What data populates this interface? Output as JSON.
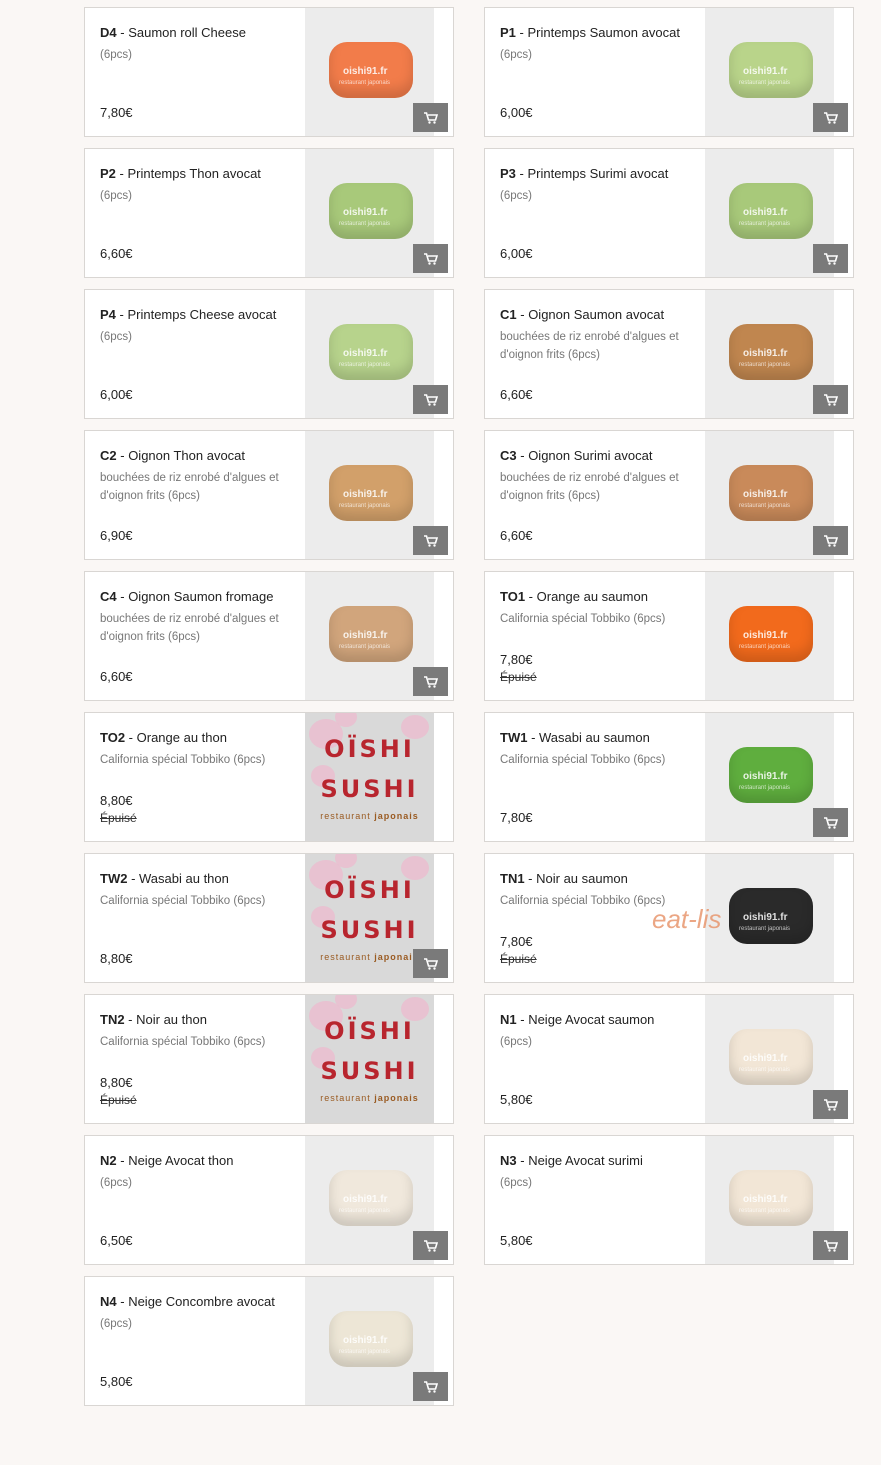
{
  "products": [
    {
      "code": "D4",
      "name": "Saumon roll Cheese",
      "desc": "(6pcs)",
      "price": "7,80€",
      "status": "",
      "img": "sushi",
      "color": "#f27c4a"
    },
    {
      "code": "P1",
      "name": "Printemps Saumon avocat",
      "desc": "(6pcs)",
      "price": "6,00€",
      "status": "",
      "img": "sushi",
      "color": "#b9d48a"
    },
    {
      "code": "P2",
      "name": "Printemps Thon avocat",
      "desc": "(6pcs)",
      "price": "6,60€",
      "status": "",
      "img": "sushi",
      "color": "#a8c97a"
    },
    {
      "code": "P3",
      "name": "Printemps Surimi avocat",
      "desc": "(6pcs)",
      "price": "6,00€",
      "status": "",
      "img": "sushi",
      "color": "#a8c97a"
    },
    {
      "code": "P4",
      "name": "Printemps Cheese avocat",
      "desc": "(6pcs)",
      "price": "6,00€",
      "status": "",
      "img": "sushi",
      "color": "#b7d38c"
    },
    {
      "code": "C1",
      "name": "Oignon Saumon avocat",
      "desc": "bouchées de riz enrobé d'algues et d'oignon frits (6pcs)",
      "price": "6,60€",
      "status": "",
      "img": "sushi",
      "color": "#c0864f"
    },
    {
      "code": "C2",
      "name": "Oignon Thon avocat",
      "desc": "bouchées de riz enrobé d'algues et d'oignon frits (6pcs)",
      "price": "6,90€",
      "status": "",
      "img": "sushi",
      "color": "#d2a06a"
    },
    {
      "code": "C3",
      "name": "Oignon Surimi avocat",
      "desc": "bouchées de riz enrobé d'algues et d'oignon frits (6pcs)",
      "price": "6,60€",
      "status": "",
      "img": "sushi",
      "color": "#c98a5a"
    },
    {
      "code": "C4",
      "name": "Oignon Saumon fromage",
      "desc": "bouchées de riz enrobé d'algues et d'oignon frits (6pcs)",
      "price": "6,60€",
      "status": "",
      "img": "sushi",
      "color": "#d1a57c"
    },
    {
      "code": "TO1",
      "name": "Orange au saumon",
      "desc": "California spécial Tobbiko (6pcs)",
      "price": "7,80€",
      "status": "Épuisé",
      "img": "sushi",
      "color": "#f26a1c"
    },
    {
      "code": "TO2",
      "name": "Orange au thon",
      "desc": "California spécial Tobbiko (6pcs)",
      "price": "8,80€",
      "status": "Épuisé",
      "img": "logo",
      "color": ""
    },
    {
      "code": "TW1",
      "name": "Wasabi au saumon",
      "desc": "California spécial Tobbiko (6pcs)",
      "price": "7,80€",
      "status": "",
      "img": "sushi",
      "color": "#5fae3e"
    },
    {
      "code": "TW2",
      "name": "Wasabi au thon",
      "desc": "California spécial Tobbiko (6pcs)",
      "price": "8,80€",
      "status": "",
      "img": "logo",
      "color": ""
    },
    {
      "code": "TN1",
      "name": "Noir au saumon",
      "desc": "California spécial Tobbiko (6pcs)",
      "price": "7,80€",
      "status": "Épuisé",
      "img": "sushi",
      "color": "#2a2a2a"
    },
    {
      "code": "TN2",
      "name": "Noir au thon",
      "desc": "California spécial Tobbiko (6pcs)",
      "price": "8,80€",
      "status": "Épuisé",
      "img": "logo",
      "color": ""
    },
    {
      "code": "N1",
      "name": "Neige Avocat saumon",
      "desc": "(6pcs)",
      "price": "5,80€",
      "status": "",
      "img": "sushi",
      "color": "#f2e6d6"
    },
    {
      "code": "N2",
      "name": "Neige Avocat thon",
      "desc": "(6pcs)",
      "price": "6,50€",
      "status": "",
      "img": "sushi",
      "color": "#f0e8dc"
    },
    {
      "code": "N3",
      "name": "Neige Avocat surimi",
      "desc": "(6pcs)",
      "price": "5,80€",
      "status": "",
      "img": "sushi",
      "color": "#f2e6d6"
    },
    {
      "code": "N4",
      "name": "Neige Concombre avocat",
      "desc": "(6pcs)",
      "price": "5,80€",
      "status": "",
      "img": "sushi",
      "color": "#ede6d6"
    }
  ],
  "cart_icon": "cart-icon",
  "watermark": {
    "main": "oishi91.fr",
    "sub": "restaurant japonais"
  },
  "logo": {
    "line1": "OÏSHI",
    "line2": "SUSHI",
    "line3_a": "restaurant",
    "line3_b": "japonais"
  },
  "overlay_text": "eat-lis"
}
